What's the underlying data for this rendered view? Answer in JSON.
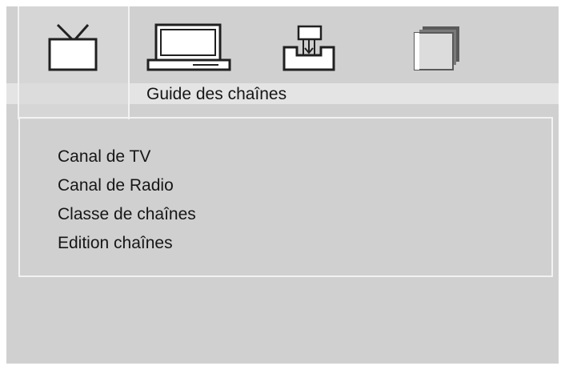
{
  "tabs": [
    {
      "icon": "tv-icon",
      "selected": true
    },
    {
      "icon": "monitor-icon",
      "selected": false
    },
    {
      "icon": "install-icon",
      "selected": false
    },
    {
      "icon": "folders-icon",
      "selected": false
    }
  ],
  "section_title": "Guide des chaînes",
  "menu": {
    "items": [
      {
        "label": "Canal de TV"
      },
      {
        "label": "Canal de Radio"
      },
      {
        "label": "Classe de chaînes"
      },
      {
        "label": "Edition chaînes"
      }
    ]
  },
  "colors": {
    "background": "#d0d0d0",
    "frame": "#f2f2f2",
    "icon": "#202020",
    "text": "#161616"
  }
}
